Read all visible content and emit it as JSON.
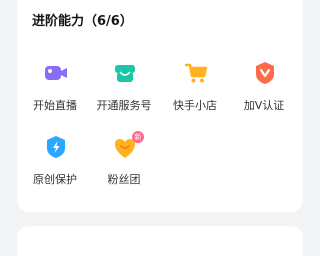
{
  "section": {
    "title": "进阶能力（6/6）"
  },
  "features": [
    {
      "label": "开始直播",
      "icon": "video-camera-icon"
    },
    {
      "label": "开通服务号",
      "icon": "service-store-icon"
    },
    {
      "label": "快手小店",
      "icon": "shopping-cart-icon"
    },
    {
      "label": "加V认证",
      "icon": "verified-v-icon"
    },
    {
      "label": "原创保护",
      "icon": "original-shield-icon"
    },
    {
      "label": "粉丝团",
      "icon": "fan-club-heart-icon",
      "badge": "新"
    }
  ],
  "colors": {
    "purple": "#8b6cf6",
    "teal": "#19c6a7",
    "orange": "#ffb21a",
    "red": "#ff6a4a",
    "blue": "#2aa7ff",
    "pink_badge": "#ff6a8a"
  }
}
